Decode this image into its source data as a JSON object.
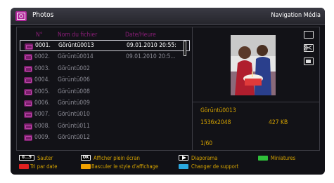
{
  "header": {
    "title": "Photos",
    "navigation": "Navigation Média"
  },
  "columns": {
    "number": "N°",
    "filename": "Nom du fichier",
    "datetime": "Date/Heure"
  },
  "files": [
    {
      "num": "0001.",
      "name": "Görüntü0013",
      "date": "09.01.2010 20:55:",
      "selected": true
    },
    {
      "num": "0002.",
      "name": "Görüntü0014",
      "date": "09.01.2010 20:5..."
    },
    {
      "num": "0003.",
      "name": "Görüntü002",
      "date": ""
    },
    {
      "num": "0004.",
      "name": "Görüntü006",
      "date": ""
    },
    {
      "num": "0005.",
      "name": "Görüntü008",
      "date": ""
    },
    {
      "num": "0006.",
      "name": "Görüntü009",
      "date": ""
    },
    {
      "num": "0007.",
      "name": "Görüntü010",
      "date": ""
    },
    {
      "num": "0008.",
      "name": "Görüntü011",
      "date": ""
    },
    {
      "num": "0009.",
      "name": "Görüntü012",
      "date": ""
    }
  ],
  "preview": {
    "filename": "Görüntü0013",
    "resolution": "1536x2048",
    "size": "427 KB",
    "position": "1/60"
  },
  "footer": {
    "key_numbers": "0...9",
    "key_ok": "OK",
    "skip": "Sauter",
    "fullscreen": "Afficher plein écran",
    "slideshow": "Diaporama",
    "thumbnails": "Miniatures",
    "sort_by_date": "Tri par date",
    "toggle_view": "Basculer le style d'affichage",
    "change_source": "Changer de support"
  },
  "colors": {
    "accent": "#8a1e78",
    "label": "#d4a200",
    "red": "#e02020",
    "green": "#2fbf3a",
    "yellow": "#f0a000",
    "blue": "#2aa8e0"
  },
  "icons": [
    "photo-app-icon",
    "frame-icon",
    "scissors-icon",
    "stop-icon",
    "play-icon"
  ]
}
